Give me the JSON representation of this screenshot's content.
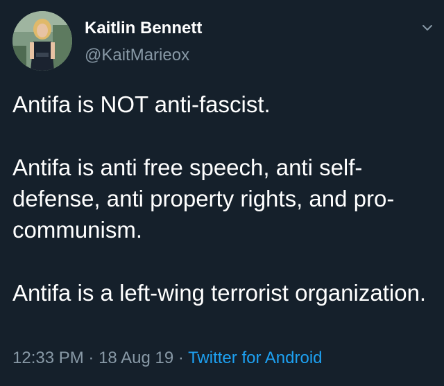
{
  "author": {
    "display_name": "Kaitlin Bennett",
    "handle": "@KaitMarieox"
  },
  "tweet": {
    "paragraphs": [
      "Antifa is NOT anti-fascist.",
      "Antifa is anti free speech, anti self-defense, anti property rights, and pro-communism.",
      "Antifa is a left-wing terrorist organization."
    ],
    "time": "12:33 PM",
    "date": "18 Aug 19",
    "separator": "·",
    "source": "Twitter for Android"
  },
  "icons": {
    "menu": "chevron-down-icon"
  },
  "colors": {
    "background": "#15202b",
    "text": "#ffffff",
    "secondary_text": "#8899a6",
    "link": "#1da1f2"
  }
}
